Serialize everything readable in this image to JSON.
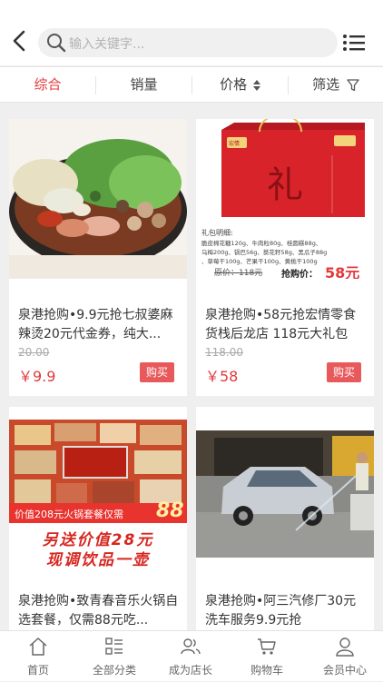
{
  "search": {
    "placeholder": "输入关键字..."
  },
  "filter_tabs": [
    {
      "label": "综合"
    },
    {
      "label": "销量"
    },
    {
      "label": "价格"
    },
    {
      "label": "筛选"
    }
  ],
  "products": [
    {
      "title": "泉港抢购•9.9元抢七叔婆麻辣烫20元代金券，纯大...",
      "original_price": "20.00",
      "price": "￥9.9",
      "buy_label": "购买"
    },
    {
      "title": "泉港抢购•58元抢宏情零食货栈后龙店 118元大礼包",
      "original_price": "118.00",
      "price": "￥58",
      "buy_label": "购买"
    },
    {
      "title": "泉港抢购•致青春音乐火锅自选套餐，仅需88元吃...",
      "original_price": "",
      "price": "",
      "buy_label": ""
    },
    {
      "title": "泉港抢购•阿三汽修厂30元洗车服务9.9元抢",
      "original_price": "",
      "price": "",
      "buy_label": ""
    }
  ],
  "gift_image": {
    "logo": "宏情",
    "bag_char": "礼",
    "list_title": "礼包明细:",
    "list_line1": "脆皮棉花糖120g、牛肉粒80g、桂圆糕88g、",
    "list_line2": "乌梅200g、锅巴56g、葵花籽58g、黑瓜子88g",
    "list_line3": "、草莓干100g、芒果干100g、黄桃干100g",
    "orig_text": "原价：118元",
    "sale_label": "抢购价：",
    "sale_price": "58元"
  },
  "hotpot_image": {
    "banner_value": "价值208元火锅套餐仅需",
    "banner_price": "88",
    "line1": "另送价值28元",
    "line2": "现调饮品一壶"
  },
  "bottom_nav": [
    {
      "label": "首页"
    },
    {
      "label": "全部分类"
    },
    {
      "label": "成为店长"
    },
    {
      "label": "购物车"
    },
    {
      "label": "会员中心"
    }
  ],
  "colors": {
    "accent": "#e4393c",
    "buy_bg": "#e8595b"
  },
  "icons": {
    "back": "chevron-left-icon",
    "search": "search-icon",
    "menu": "list-icon",
    "sort": "sort-arrows-icon",
    "filter": "filter-funnel-icon",
    "nav": [
      "home-icon",
      "category-icon",
      "users-icon",
      "cart-icon",
      "user-icon"
    ]
  }
}
